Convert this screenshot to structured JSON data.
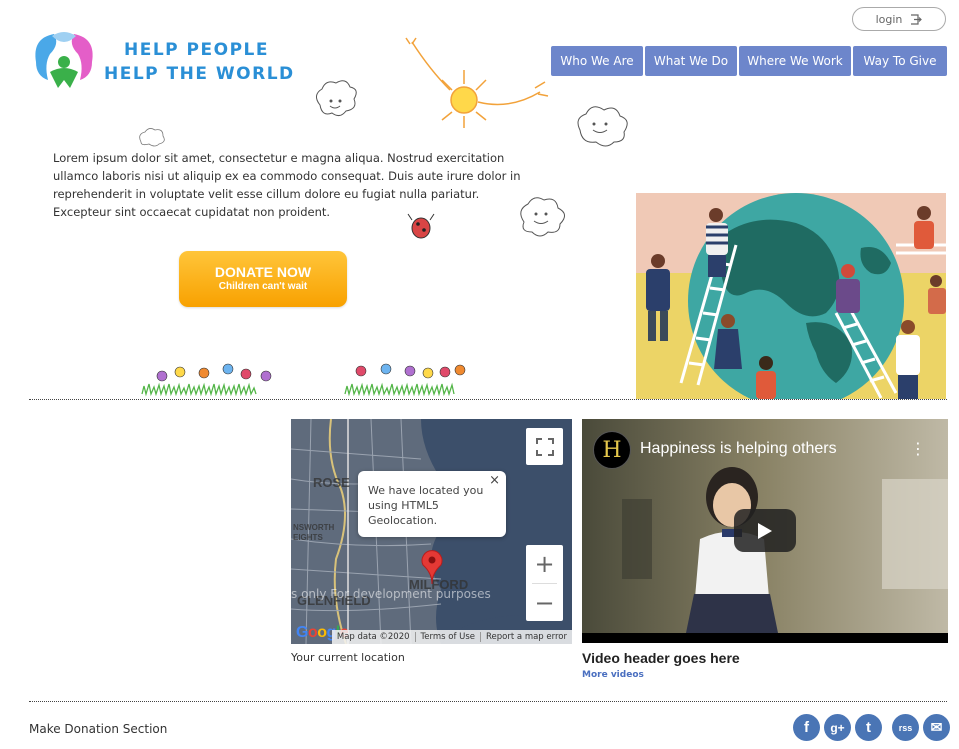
{
  "brand": {
    "line1": "HELP PEOPLE",
    "line2": "HELP THE WORLD",
    "logo_icon": "people-hug-logo-icon",
    "accent": "#2a8fd6"
  },
  "header": {
    "login_label": "login",
    "login_icon": "sign-in-icon"
  },
  "nav": {
    "items": [
      {
        "label": "Who We Are"
      },
      {
        "label": "What We Do"
      },
      {
        "label": "Where We Work"
      },
      {
        "label": "Way To Give"
      }
    ],
    "color": "#6d86cb"
  },
  "intro": {
    "text": "Lorem ipsum dolor sit amet, consectetur e magna aliqua. Nostrud exercitation ullamco laboris nisi ut aliquip ex ea commodo consequat. Duis aute irure dolor in reprehenderit in voluptate velit esse cillum dolore eu fugiat nulla pariatur. Excepteur sint occaecat cupidatat non proident."
  },
  "donate": {
    "label": "DONATE NOW",
    "sublabel": "Children can't wait",
    "color": "#f8a100"
  },
  "map": {
    "popup_text": "We have located you using HTML5 Geolocation.",
    "popup_close": "×",
    "zoom_in": "+",
    "zoom_out": "−",
    "dev_text": "s only       For development purposes",
    "places": [
      "ROSE",
      "MILFORD",
      "GLENFIELD",
      "NSWORTH",
      "EIGHTS"
    ],
    "attribution": [
      "Map data ©2020",
      "Terms of Use",
      "Report a map error"
    ],
    "google": "Google",
    "caption": "Your current location"
  },
  "video": {
    "channel_letter": "H",
    "title": "Happiness is helping others",
    "menu": "⋮",
    "header": "Video header goes here",
    "more": "More videos"
  },
  "footer": {
    "label": "Make Donation Section",
    "social": [
      {
        "icon": "facebook-icon",
        "glyph": "f"
      },
      {
        "icon": "google-plus-icon",
        "glyph": "g+"
      },
      {
        "icon": "twitter-icon",
        "glyph": "t"
      },
      {
        "icon": "rss-icon",
        "glyph": "rss"
      },
      {
        "icon": "email-icon",
        "glyph": "✉"
      }
    ],
    "social_color": "#4a75b5"
  }
}
